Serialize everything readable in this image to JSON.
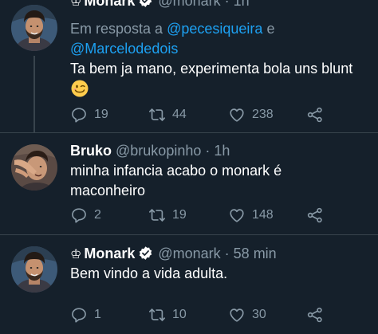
{
  "tweets": [
    {
      "crown": "♔",
      "name": "Monark",
      "handle": "@monark",
      "time": "· 1h",
      "reply_label": "Em resposta a",
      "mention_1": "@pecesiqueira",
      "mention_joiner": "e",
      "mention_2": "@Marcelodedois",
      "text": "Ta bem ja mano, experimenta bola uns blunt",
      "emoji": "winking-face",
      "replies": "19",
      "retweets": "44",
      "likes": "238"
    },
    {
      "name": "Bruko",
      "handle": "@brukopinho",
      "time": "· 1h",
      "text": "minha infancia acabo o monark é maconheiro",
      "replies": "2",
      "retweets": "19",
      "likes": "148"
    },
    {
      "crown": "♔",
      "name": "Monark",
      "handle": "@monark",
      "time": "· 58 min",
      "text": "Bem vindo a vida adulta.",
      "replies": "1",
      "retweets": "10",
      "likes": "30"
    }
  ],
  "colors": {
    "background": "#15202b",
    "text": "#ffffff",
    "secondary": "#8899a6",
    "link": "#1da1f2",
    "divider": "#38444d"
  },
  "icons": [
    "reply-icon",
    "retweet-icon",
    "like-icon",
    "share-icon",
    "verified-badge-icon",
    "crown-icon"
  ]
}
